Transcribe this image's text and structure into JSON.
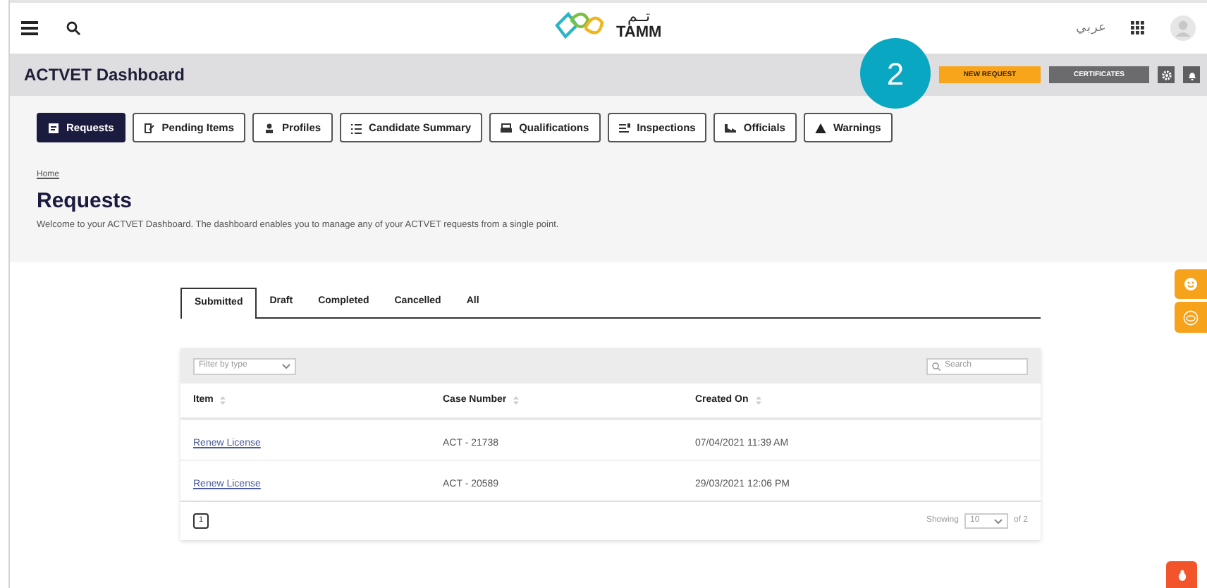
{
  "top_bar": {
    "logo_arabic": "تــم",
    "logo_text": "TAMM",
    "language": "عربي"
  },
  "header": {
    "title": "ACTVET Dashboard",
    "step_badge": "2",
    "buttons": [
      "NEW REQUEST",
      "CERTIFICATES"
    ]
  },
  "nav": [
    {
      "label": "Requests",
      "selected": true
    },
    {
      "label": "Pending Items",
      "selected": false
    },
    {
      "label": "Profiles",
      "selected": false
    },
    {
      "label": "Candidate Summary",
      "selected": false
    },
    {
      "label": "Qualifications",
      "selected": false
    },
    {
      "label": "Inspections",
      "selected": false
    },
    {
      "label": "Officials",
      "selected": false
    },
    {
      "label": "Warnings",
      "selected": false
    }
  ],
  "breadcrumb": "Home",
  "title": "Requests",
  "description": "Welcome to your ACTVET Dashboard. The dashboard enables you to manage any of your ACTVET requests from a single point.",
  "tabs": [
    {
      "label": "Submitted",
      "selected": true
    },
    {
      "label": "Draft",
      "selected": false
    },
    {
      "label": "Completed",
      "selected": false
    },
    {
      "label": "Cancelled",
      "selected": false
    },
    {
      "label": "All",
      "selected": false
    }
  ],
  "filter": {
    "placeholder": "Filter by type"
  },
  "search": {
    "placeholder": "Search"
  },
  "table": {
    "columns": [
      "Item",
      "Case Number",
      "Created On"
    ],
    "rows": [
      [
        "Renew License",
        "ACT - 21738",
        "07/04/2021 11:39 AM"
      ],
      [
        "Renew License",
        "ACT - 20589",
        "29/03/2021 12:06 PM"
      ]
    ]
  },
  "pagination": {
    "page": "1",
    "showing_label": "Showing",
    "page_size": "10",
    "of_total": "of 2"
  }
}
